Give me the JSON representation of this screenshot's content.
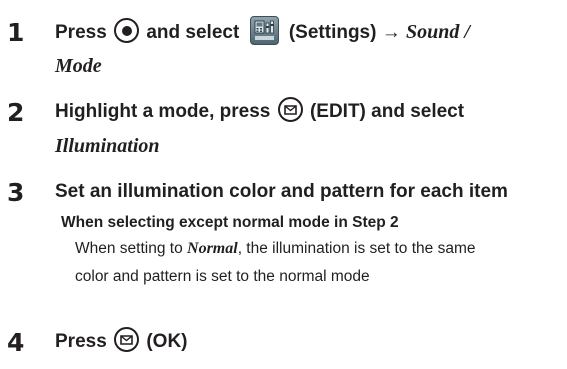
{
  "steps": [
    {
      "number": "1",
      "line1": {
        "press": "Press",
        "and_select": "and select",
        "settings_label": "(Settings)",
        "arrow": "→",
        "menu": "Sound /"
      },
      "line2": {
        "menu": "Mode"
      }
    },
    {
      "number": "2",
      "line1": {
        "text_before": "Highlight a mode, press",
        "text_after": "(EDIT) and select"
      },
      "line2": {
        "menu": "Illumination"
      }
    },
    {
      "number": "3",
      "line1": {
        "text": "Set an illumination color and pattern for each item"
      },
      "subheading": "When selecting except normal mode in Step 2",
      "body_line1": {
        "prefix": "When setting to",
        "menu": "Normal",
        "suffix": ", the illumination is set to the same"
      },
      "body_line2": "color and pattern is set to the normal mode"
    },
    {
      "number": "4",
      "line1": {
        "press": "Press",
        "text_after": "(OK)"
      }
    }
  ],
  "icons": {
    "center_key": "center-key-icon",
    "mail_key": "mail-key-icon",
    "settings": "settings-app-icon"
  },
  "colors": {
    "text": "#231f20",
    "background": "#ffffff"
  }
}
